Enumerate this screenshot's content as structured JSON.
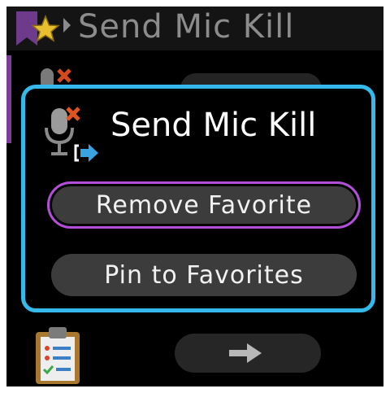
{
  "header": {
    "title": "Send Mic Kill",
    "icon": "favorites-star-icon"
  },
  "popup": {
    "title": "Send Mic Kill",
    "icon": "mic-kill-send-icon",
    "actions": [
      {
        "label": "Remove Favorite",
        "selected": true
      },
      {
        "label": "Pin to Favorites",
        "selected": false
      }
    ]
  },
  "background": {
    "top_item_icon": "mic-kill-icon",
    "bottom_item_icon": "clipboard-checklist-icon",
    "bottom_item_button_icon": "arrow-right-icon"
  },
  "colors": {
    "screen_bg": "#000000",
    "popup_border": "#35b8ea",
    "selected_border": "#b24fd8",
    "button_bg": "#3c3c3c",
    "accent": "#7b3d9a"
  }
}
